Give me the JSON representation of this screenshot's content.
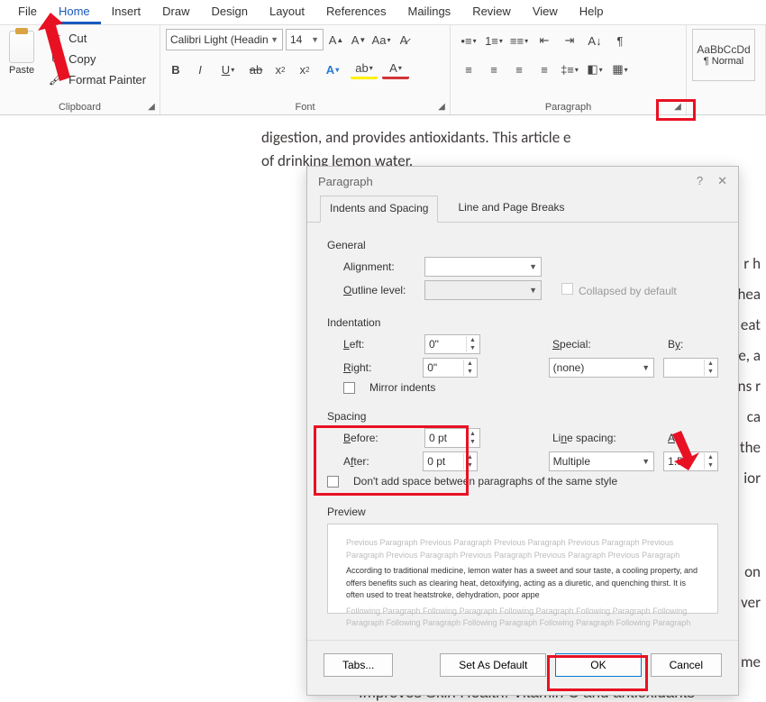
{
  "menu": {
    "items": [
      "File",
      "Home",
      "Insert",
      "Draw",
      "Design",
      "Layout",
      "References",
      "Mailings",
      "Review",
      "View",
      "Help"
    ],
    "active": "Home"
  },
  "clipboard": {
    "paste": "Paste",
    "cut": "Cut",
    "copy": "Copy",
    "format_painter": "Format Painter",
    "label": "Clipboard"
  },
  "font": {
    "name": "Calibri Light (Headin",
    "size": "14",
    "label": "Font"
  },
  "paragraph": {
    "label": "Paragraph"
  },
  "styles": {
    "sample": "AaBbCcDd",
    "name": "¶ Normal"
  },
  "doc": {
    "line1": "digestion, and provides antioxidants. This article e",
    "line2": "of drinking lemon water.",
    "line3": "r h",
    "line4": "hea",
    "line5": "eat",
    "line6": "e, a",
    "line7": "ns r",
    "line8": " ca",
    "line9": " the",
    "line10": "ior",
    "line11": "on",
    "line12": "ver",
    "line13": "me",
    "bottom": "Improves Skin Health: Vitamin C and antioxidants"
  },
  "dialog": {
    "title": "Paragraph",
    "tabs": {
      "indent": "Indents and Spacing",
      "line": "Line and Page Breaks"
    },
    "general": {
      "label": "General",
      "alignment_label": "Alignment:",
      "alignment": "",
      "outline_label": "Outline level:",
      "outline": "",
      "collapsed": "Collapsed by default"
    },
    "indentation": {
      "label": "Indentation",
      "left_label": "Left:",
      "left": "0\"",
      "right_label": "Right:",
      "right": "0\"",
      "special_label": "Special:",
      "special": "(none)",
      "by_label": "By:",
      "by": "",
      "mirror": "Mirror indents"
    },
    "spacing": {
      "label": "Spacing",
      "before_label": "Before:",
      "before": "0 pt",
      "after_label": "After:",
      "after": "0 pt",
      "line_label": "Line spacing:",
      "line": "Multiple",
      "at_label": "At:",
      "at": "1.5",
      "dont_add": "Don't add space between paragraphs of the same style"
    },
    "preview": {
      "label": "Preview",
      "prev": "Previous Paragraph Previous Paragraph Previous Paragraph Previous Paragraph Previous Paragraph Previous Paragraph Previous Paragraph Previous Paragraph Previous Paragraph",
      "sample": "According to traditional medicine, lemon water has a sweet and sour taste, a cooling property, and offers benefits such as clearing heat, detoxifying, acting as a diuretic, and quenching thirst. It is often used to treat heatstroke, dehydration, poor appe",
      "next": "Following Paragraph Following Paragraph Following Paragraph Following Paragraph Following Paragraph Following Paragraph Following Paragraph Following Paragraph Following Paragraph"
    },
    "footer": {
      "tabs": "Tabs...",
      "default": "Set As Default",
      "ok": "OK",
      "cancel": "Cancel"
    }
  }
}
